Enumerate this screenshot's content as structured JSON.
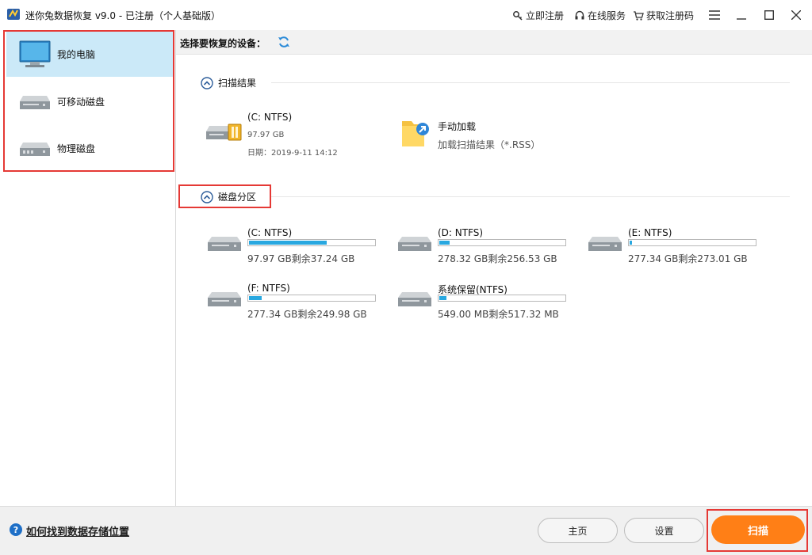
{
  "titlebar": {
    "title": "迷你兔数据恢复 v9.0 - 已注册（个人基础版）",
    "links": [
      "立即注册",
      "在线服务",
      "获取注册码"
    ],
    "icons": [
      "menu-icon",
      "minimize-icon",
      "maximize-icon",
      "close-icon"
    ]
  },
  "sidebar": {
    "items": [
      {
        "label": "我的电脑",
        "icon": "monitor-icon"
      },
      {
        "label": "可移动磁盘",
        "icon": "removable-disk-icon"
      },
      {
        "label": "物理磁盘",
        "icon": "physical-disk-icon"
      }
    ]
  },
  "main": {
    "header_label": "选择要恢复的设备：",
    "scan_results": {
      "title": "扫描结果",
      "items": [
        {
          "name": "(C: NTFS)",
          "size": "97.97 GB",
          "date": "日期：2019-9-11 14:12"
        },
        {
          "name": "手动加载",
          "desc": "加载扫描结果（*.RSS）"
        }
      ]
    },
    "partitions": {
      "title": "磁盘分区",
      "items": [
        {
          "name": "(C: NTFS)",
          "size": "97.97 GB剩余37.24 GB",
          "used_fraction": 0.62
        },
        {
          "name": "(D: NTFS)",
          "size": "278.32 GB剩余256.53 GB",
          "used_fraction": 0.08
        },
        {
          "name": "(E: NTFS)",
          "size": "277.34 GB剩余273.01 GB",
          "used_fraction": 0.02
        },
        {
          "name": "(F: NTFS)",
          "size": "277.34 GB剩余249.98 GB",
          "used_fraction": 0.1
        },
        {
          "name": "系统保留(NTFS)",
          "size": "549.00 MB剩余517.32 MB",
          "used_fraction": 0.06
        }
      ]
    }
  },
  "footer": {
    "help_link": "如何找到数据存储位置",
    "home_label": "主页",
    "settings_label": "设置",
    "scan_label": "扫描"
  },
  "colors": {
    "accent": "#ff7f16",
    "bar_fill": "#29a8e0",
    "highlight": "#e53935",
    "sidebar_active": "#cbe9f8"
  }
}
